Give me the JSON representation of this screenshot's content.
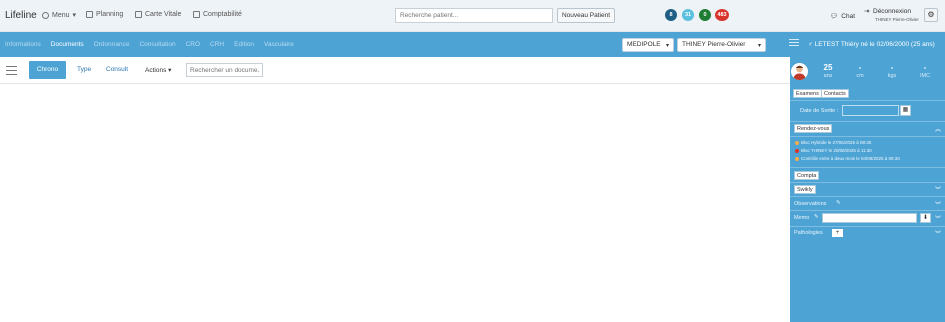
{
  "topbar": {
    "brand": "Lifeline",
    "menu_label": "Menu",
    "planning_label": "Planning",
    "carte_vitale_label": "Carte Vitale",
    "comptabilite_label": "Comptabilité",
    "search_placeholder": "Recherche patient...",
    "new_patient_label": "Nouveau Patient",
    "badges": [
      {
        "value": "8",
        "color": "#1f5f86"
      },
      {
        "value": "31",
        "color": "#5bc0de"
      },
      {
        "value": "0",
        "color": "#1e7d32"
      },
      {
        "value": "483",
        "color": "#d9342b"
      }
    ],
    "chat_label": "Chat",
    "logout_label": "Déconnexion",
    "logout_user": "THINEY Pierre-Olivier"
  },
  "nav": {
    "tabs": [
      "Informations",
      "Documents",
      "Ordonnance",
      "Consultation",
      "CRO",
      "CRH",
      "Edition",
      "Vasculaire"
    ],
    "active_tab": "Documents",
    "site_select": "MEDIPOLE",
    "doctor_select": "THINEY Pierre-Olivier",
    "patient_info": "LETEST Thiéry né le 02/06/2000 (25 ans)"
  },
  "toolbar": {
    "chrono_label": "Chrono",
    "type_label": "Type",
    "consult_label": "Consult",
    "actions_label": "Actions",
    "doc_search_placeholder": "Rechercher un docume..."
  },
  "panel": {
    "stats": [
      {
        "value": "25",
        "unit": "ans"
      },
      {
        "value": "-",
        "unit": "cm"
      },
      {
        "value": "-",
        "unit": "kgs"
      },
      {
        "value": "-",
        "unit": "IMC"
      }
    ],
    "examens_label": "Examens",
    "contacts_label": "Contacts",
    "date_sortie_label": "Date de Sortie :",
    "rdv_label": "Rendez-vous",
    "rdv_items": [
      {
        "text": "Bloc Hybride le 27/06/2025 à 08:30",
        "color": "#f0ad4e"
      },
      {
        "text": "Bloc THINEY le 20/08/2025 à 11:30",
        "color": "#d9342b"
      },
      {
        "text": "Contrôle entre à deux mois le 04/08/2025 à 08:30",
        "color": "#f0ad4e"
      }
    ],
    "compta_label": "Compta",
    "swikly_label": "Swikly",
    "observations_label": "Observations",
    "memo_label": "Memo",
    "pathologies_label": "Pathologies"
  }
}
